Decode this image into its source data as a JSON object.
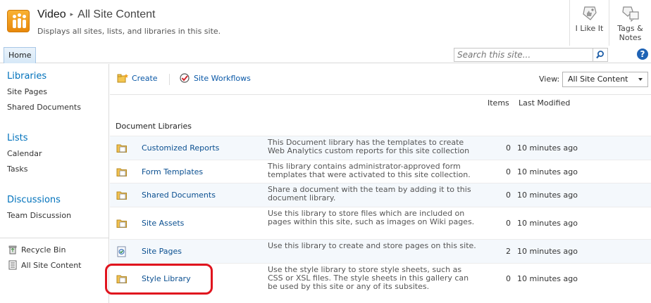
{
  "header": {
    "site_title": "Video",
    "page_title": "All Site Content",
    "separator": "▸",
    "description": "Displays all sites, lists, and libraries in this site."
  },
  "social": {
    "like_label": "I Like It",
    "tags_label_1": "Tags &",
    "tags_label_2": "Notes"
  },
  "nav": {
    "home_tab": "Home",
    "search_placeholder": "Search this site...",
    "help_glyph": "?"
  },
  "quick_launch": {
    "libraries": {
      "heading": "Libraries",
      "items": [
        "Site Pages",
        "Shared Documents"
      ]
    },
    "lists": {
      "heading": "Lists",
      "items": [
        "Calendar",
        "Tasks"
      ]
    },
    "discussions": {
      "heading": "Discussions",
      "items": [
        "Team Discussion"
      ]
    },
    "recycle_bin": "Recycle Bin",
    "all_site_content": "All Site Content"
  },
  "toolbar": {
    "create_label": "Create",
    "workflows_label": "Site Workflows",
    "view_label": "View:",
    "view_value": "All Site Content"
  },
  "columns": {
    "items": "Items",
    "last_modified": "Last Modified"
  },
  "section": {
    "title": "Document Libraries"
  },
  "libraries": [
    {
      "name": "Customized Reports",
      "description": "This Document library has the templates to create Web Analytics custom reports for this site collection",
      "items": "0",
      "modified": "10 minutes ago"
    },
    {
      "name": "Form Templates",
      "description": "This library contains administrator-approved form templates that were activated to this site collection.",
      "items": "0",
      "modified": "10 minutes ago"
    },
    {
      "name": "Shared Documents",
      "description": "Share a document with the team by adding it to this document library.",
      "items": "0",
      "modified": "10 minutes ago"
    },
    {
      "name": "Site Assets",
      "description": "Use this library to store files which are included on pages within this site, such as images on Wiki pages.",
      "items": "0",
      "modified": "10 minutes ago"
    },
    {
      "name": "Site Pages",
      "description": "Use this library to create and store pages on this site.",
      "items": "2",
      "modified": "10 minutes ago"
    },
    {
      "name": "Style Library",
      "description": "Use the style library to store style sheets, such as CSS or XSL files. The style sheets in this gallery can be used by this site or any of its subsites.",
      "items": "0",
      "modified": "10 minutes ago"
    }
  ],
  "colors": {
    "link": "#0a4f90",
    "heading": "#0072bc",
    "highlight": "#e0141e"
  }
}
